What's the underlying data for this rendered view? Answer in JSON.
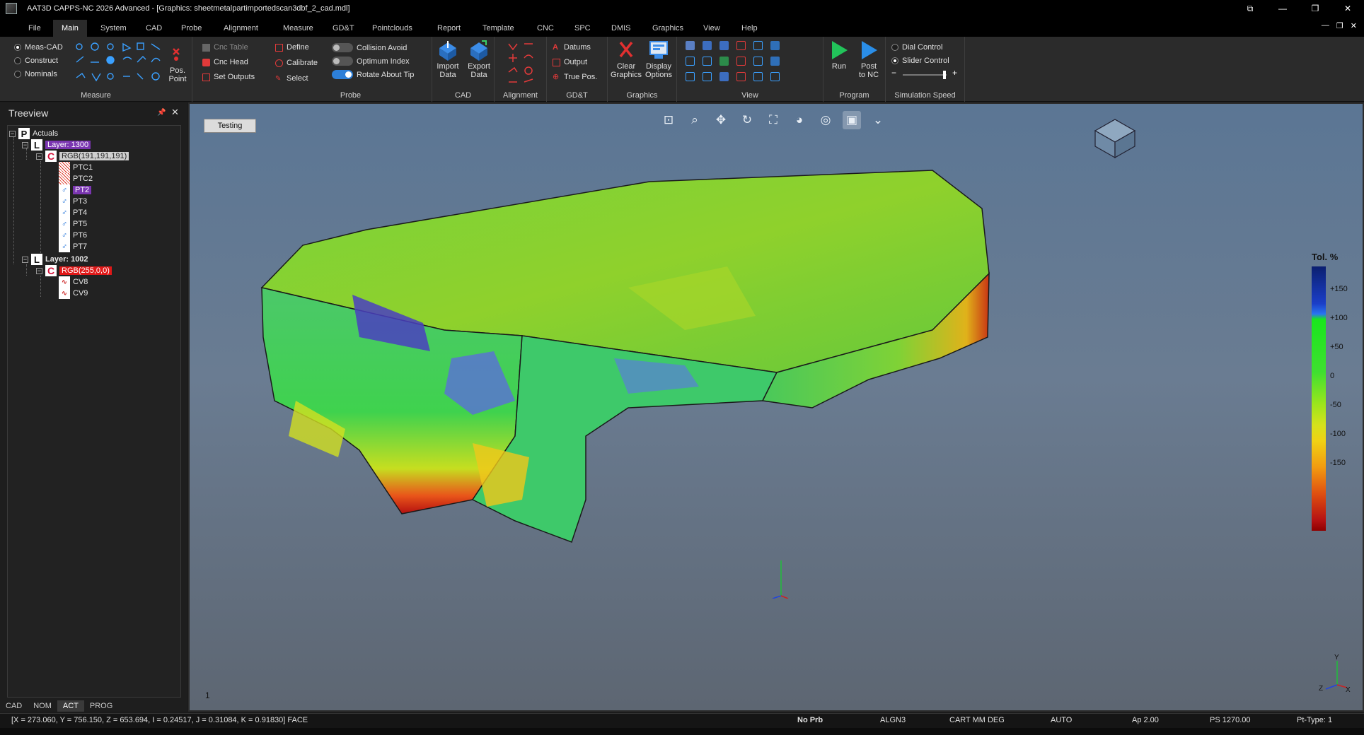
{
  "window": {
    "title": "AAT3D CAPPS-NC 2026 Advanced - [Graphics: sheetmetalpartimportedscan3dbf_2_cad.mdl]",
    "controls": [
      "⧉",
      "—",
      "❐",
      "✕"
    ]
  },
  "menu": {
    "tabs": [
      "File",
      "Main",
      "System",
      "CAD",
      "Probe",
      "Alignment",
      "Measure",
      "GD&T",
      "Pointclouds",
      "Report",
      "Template",
      "CNC",
      "SPC",
      "DMIS",
      "Graphics",
      "View",
      "Help"
    ],
    "active": "Main",
    "mdi_controls": [
      "—",
      "❐",
      "✕"
    ]
  },
  "ribbon": {
    "measure": {
      "label": "Measure",
      "modes": [
        "Meas-CAD",
        "Construct",
        "Nominals"
      ],
      "selected_mode": "Meas-CAD",
      "pos_point": "Pos.\nPoint"
    },
    "cnc": {
      "items": [
        "Cnc Table",
        "Cnc Head",
        "Set Outputs"
      ]
    },
    "probe": {
      "label": "Probe",
      "items": [
        "Define",
        "Calibrate",
        "Select"
      ],
      "toggles": [
        {
          "label": "Collision Avoid",
          "on": false
        },
        {
          "label": "Optimum Index",
          "on": false
        },
        {
          "label": "Rotate About Tip",
          "on": true
        }
      ]
    },
    "cad": {
      "label": "CAD",
      "import": "Import\nData",
      "export": "Export\nData"
    },
    "alignment": {
      "label": "Alignment"
    },
    "gdt": {
      "label": "GD&T",
      "items": [
        "Datums",
        "Output",
        "True Pos."
      ]
    },
    "graphics": {
      "label": "Graphics",
      "clear": "Clear\nGraphics",
      "display": "Display\nOptions"
    },
    "view": {
      "label": "View"
    },
    "program": {
      "label": "Program",
      "run": "Run",
      "post": "Post\nto NC"
    },
    "sim_speed": {
      "label": "Simulation Speed",
      "options": [
        "Dial Control",
        "Slider Control"
      ],
      "selected": "Slider Control",
      "slider_level": 0.95
    }
  },
  "treeview": {
    "title": "Treeview",
    "nodes": [
      {
        "label": "Actuals",
        "icon": "P"
      },
      {
        "label": "Layer: 1300",
        "icon": "L"
      },
      {
        "label": "RGB(191,191,191)",
        "icon": "C"
      },
      {
        "label": "PTC1",
        "icon": "ptc"
      },
      {
        "label": "PTC2",
        "icon": "ptc"
      },
      {
        "label": "PT2",
        "icon": "pt"
      },
      {
        "label": "PT3",
        "icon": "pt"
      },
      {
        "label": "PT4",
        "icon": "pt"
      },
      {
        "label": "PT5",
        "icon": "pt"
      },
      {
        "label": "PT6",
        "icon": "pt"
      },
      {
        "label": "PT7",
        "icon": "pt"
      },
      {
        "label": "Layer: 1002",
        "icon": "L"
      },
      {
        "label": "RGB(255,0,0)",
        "icon": "C"
      },
      {
        "label": "CV8",
        "icon": "cv"
      },
      {
        "label": "CV9",
        "icon": "cv"
      }
    ],
    "bottom_tabs": [
      "CAD",
      "NOM",
      "ACT",
      "PROG"
    ],
    "active_tab": "ACT"
  },
  "viewport": {
    "testing_button": "Testing",
    "frame_number": "1",
    "legend": {
      "title": "Tol. %",
      "ticks": [
        "+150",
        "+100",
        "+50",
        "0",
        "-50",
        "-100",
        "-150"
      ]
    },
    "axis_labels": {
      "y": "Y",
      "z": "Z",
      "x": "X"
    }
  },
  "status": {
    "coords": "[X = 273.060, Y = 756.150, Z = 653.694, I = 0.24517, J = 0.31084, K = 0.91830] FACE",
    "probe": "No Prb",
    "alignment": "ALGN3",
    "units": "CART MM DEG",
    "mode": "AUTO",
    "approach": "Ap 2.00",
    "ps": "PS 1270.00",
    "pt_type": "Pt-Type: 1"
  }
}
